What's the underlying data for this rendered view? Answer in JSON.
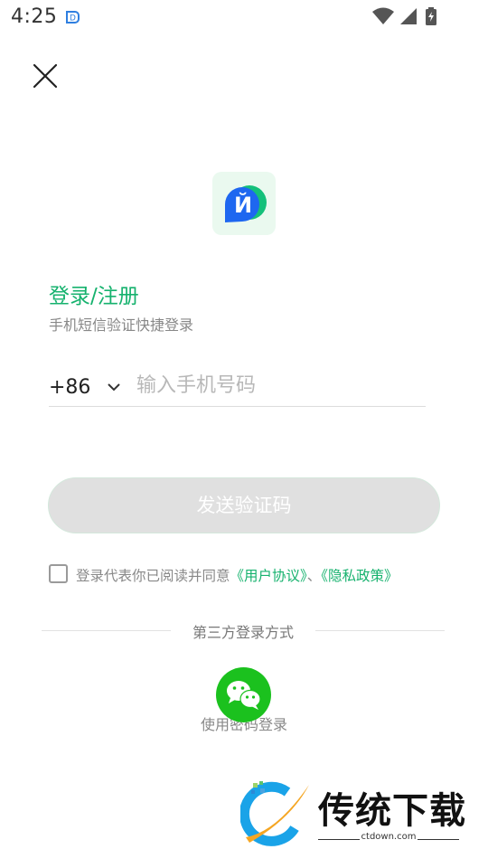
{
  "status_bar": {
    "time": "4:25",
    "app_icon": "d-shield-icon",
    "icons": [
      "wifi-icon",
      "signal-icon",
      "battery-charging-icon"
    ]
  },
  "header": {
    "close_icon": "close-icon"
  },
  "logo": {
    "letter": "Й",
    "colors": {
      "blue": "#1e67f0",
      "green": "#14c07a",
      "background": "#eaf9ef"
    }
  },
  "login": {
    "title": "登录/注册",
    "subtitle": "手机短信验证快捷登录",
    "country_code": "+86",
    "phone_placeholder": "输入手机号码",
    "send_code_label": "发送验证码"
  },
  "agreement": {
    "prefix": "登录代表你已阅读并同意",
    "user_agreement": "《用户协议》",
    "separator": "、",
    "privacy_policy": "《隐私政策》"
  },
  "third_party": {
    "divider_label": "第三方登录方式",
    "wechat_icon": "wechat-icon",
    "password_login_label": "使用密码登录"
  },
  "watermark": {
    "brand": "传统下载",
    "url": "ctdown.com"
  },
  "colors": {
    "accent": "#16b26e",
    "wechat": "#1bc11e",
    "button_disabled": "#e0e0e0"
  }
}
